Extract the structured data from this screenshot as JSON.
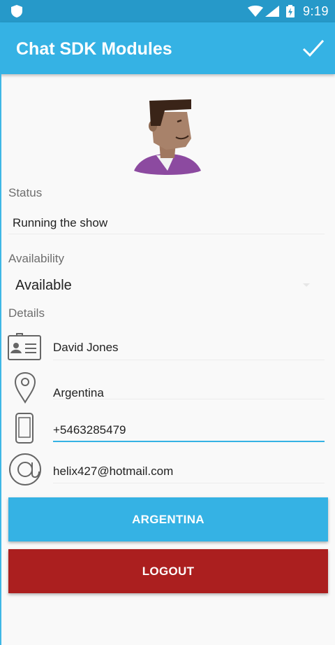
{
  "status_bar": {
    "time": "9:19"
  },
  "app_bar": {
    "title": "Chat SDK Modules"
  },
  "profile": {
    "status_label": "Status",
    "status_value": "Running the show",
    "availability_label": "Availability",
    "availability_value": "Available",
    "details_label": "Details",
    "details": [
      {
        "icon": "id-card-icon",
        "value": "David Jones"
      },
      {
        "icon": "location-pin-icon",
        "value": "Argentina"
      },
      {
        "icon": "phone-icon",
        "value": "+5463285479"
      },
      {
        "icon": "at-sign-icon",
        "value": "helix427@hotmail.com"
      }
    ]
  },
  "buttons": {
    "country": "ARGENTINA",
    "logout": "LOGOUT"
  },
  "colors": {
    "status_bar": "#2699c9",
    "app_bar": "#35b2e4",
    "logout": "#ab1f1f",
    "focus_underline": "#35b2e4"
  }
}
